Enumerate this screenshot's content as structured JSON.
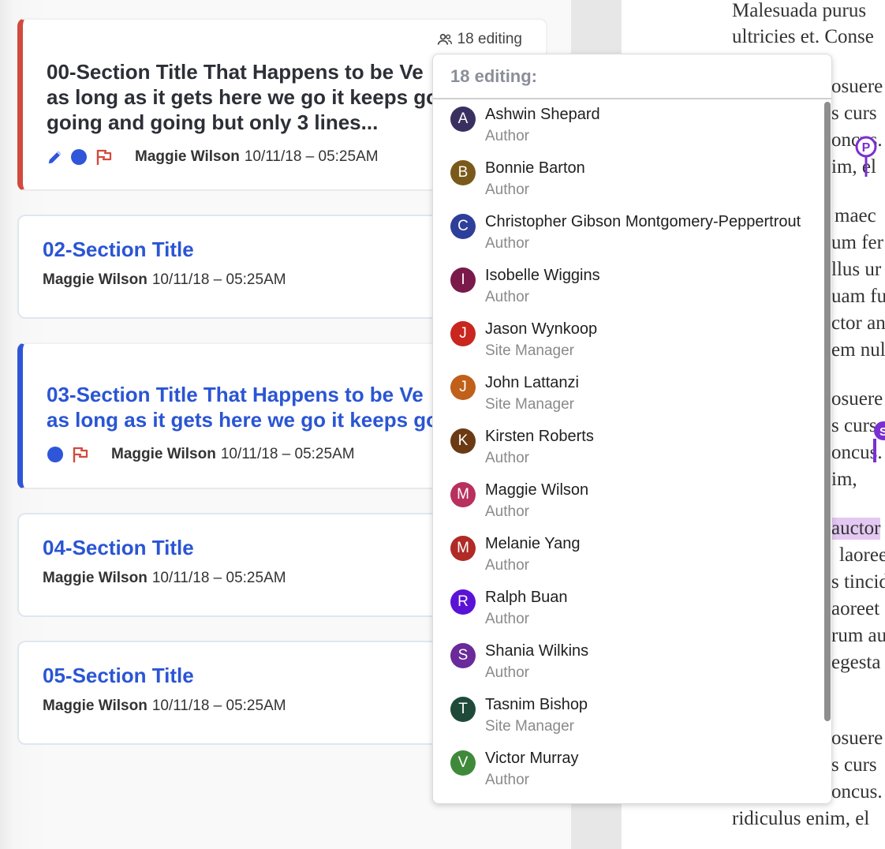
{
  "cards": [
    {
      "title_line1": "00-Section Title That Happens to be Ve",
      "title_line2": "as long as it gets here we go it keeps go",
      "title_line3": "going and going but only 3 lines...",
      "author": "Maggie Wilson",
      "date": "10/11/18 – 05:25AM",
      "editing_label": "18 editing"
    },
    {
      "title": "02-Section Title",
      "author": "Maggie Wilson",
      "date": "10/11/18 – 05:25AM"
    },
    {
      "title_line1": "03-Section Title That Happens to be Ve",
      "title_line2": "as long as it gets here we go it keeps go",
      "author": "Maggie Wilson",
      "date": "10/11/18 – 05:25AM"
    },
    {
      "title": "04-Section Title",
      "author": "Maggie Wilson",
      "date": "10/11/18 – 05:25AM"
    },
    {
      "title": "05-Section Title",
      "author": "Maggie Wilson",
      "date": "10/11/18 – 05:25AM"
    }
  ],
  "popup": {
    "header": "18 editing:",
    "users": [
      {
        "initial": "A",
        "name": "Ashwin Shepard",
        "role": "Author",
        "color": "#3a3060"
      },
      {
        "initial": "B",
        "name": "Bonnie Barton",
        "role": "Author",
        "color": "#7a5a1a"
      },
      {
        "initial": "C",
        "name": "Christopher Gibson Montgomery-Peppertrout",
        "role": "Author",
        "color": "#2e3f9a"
      },
      {
        "initial": "I",
        "name": "Isobelle Wiggins",
        "role": "Author",
        "color": "#7a1a4a"
      },
      {
        "initial": "J",
        "name": "Jason Wynkoop",
        "role": "Site Manager",
        "color": "#c8261e"
      },
      {
        "initial": "J",
        "name": "John Lattanzi",
        "role": "Site Manager",
        "color": "#c0601a"
      },
      {
        "initial": "K",
        "name": "Kirsten Roberts",
        "role": "Author",
        "color": "#6b3a12"
      },
      {
        "initial": "M",
        "name": "Maggie Wilson",
        "role": "Author",
        "color": "#b8305e"
      },
      {
        "initial": "M",
        "name": "Melanie Yang",
        "role": "Author",
        "color": "#b02a26"
      },
      {
        "initial": "R",
        "name": "Ralph Buan",
        "role": "Author",
        "color": "#5a12d6"
      },
      {
        "initial": "S",
        "name": "Shania Wilkins",
        "role": "Author",
        "color": "#6a2a9a"
      },
      {
        "initial": "T",
        "name": "Tasnim Bishop",
        "role": "Site Manager",
        "color": "#1f4a3a"
      },
      {
        "initial": "V",
        "name": "Victor Murray",
        "role": "Author",
        "color": "#3f8a3a"
      }
    ]
  },
  "document": {
    "lines": [
      "Malesuada purus",
      "ultricies et. Conse",
      "osuere",
      "s curs",
      "oncus.",
      "im, el",
      "maec",
      "um fer",
      "llus ur",
      "uam fu",
      "ctor an",
      "em nul",
      "osuere",
      "s curs",
      "oncus.",
      "im,",
      "auctor",
      "laoree",
      "s tincid",
      "aoreet",
      "rum au",
      "egesta",
      "osuere",
      "s curs",
      "oncus.",
      "ridiculus enim, el"
    ],
    "pins": [
      "P",
      "S"
    ]
  },
  "colors": {
    "accent_red": "#d24a3c",
    "accent_blue": "#2f56d8",
    "title_blue": "#2a55d4",
    "dot_blue": "#2f56d8",
    "flag_red": "#d24a3c",
    "pin_purple": "#7b2fd0"
  }
}
